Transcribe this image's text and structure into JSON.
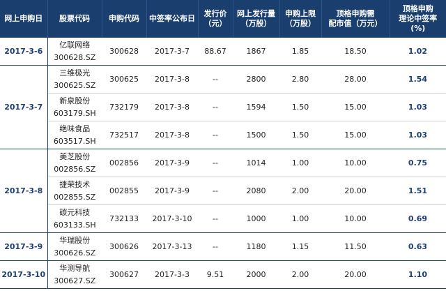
{
  "headers": [
    "网上申购日",
    "股票代码",
    "申购代码",
    "中签率公布日",
    "发行价\n（元）",
    "网上发行量\n（万股）",
    "申购上限\n（万股）",
    "顶格申购需\n配市值（万元）",
    "顶格申购\n理论中签率\n(%)"
  ],
  "groups": [
    {
      "date": "2017-3-6",
      "rows": [
        {
          "name": "亿联网络",
          "code": "300628.SZ",
          "sub_code": "300628",
          "announce": "2017-3-7",
          "price": "88.67",
          "volume": "1867",
          "limit": "1.85",
          "market_value": "18.50",
          "rate": "1.02"
        }
      ]
    },
    {
      "date": "2017-3-7",
      "rows": [
        {
          "name": "三维极光",
          "code": "300625.SZ",
          "sub_code": "300625",
          "announce": "2017-3-8",
          "price": "--",
          "volume": "2800",
          "limit": "2.80",
          "market_value": "28.00",
          "rate": "1.54"
        },
        {
          "name": "新泉股份",
          "code": "603179.SH",
          "sub_code": "732179",
          "announce": "2017-3-8",
          "price": "--",
          "volume": "1594",
          "limit": "1.50",
          "market_value": "15.00",
          "rate": "1.03"
        },
        {
          "name": "绝味食品",
          "code": "603517.SH",
          "sub_code": "732517",
          "announce": "2017-3-8",
          "price": "--",
          "volume": "1500",
          "limit": "1.50",
          "market_value": "15.00",
          "rate": "1.03"
        }
      ]
    },
    {
      "date": "2017-3-8",
      "rows": [
        {
          "name": "美芝股份",
          "code": "002856.SZ",
          "sub_code": "002856",
          "announce": "2017-3-9",
          "price": "--",
          "volume": "1014",
          "limit": "1.00",
          "market_value": "10.00",
          "rate": "0.75"
        },
        {
          "name": "捷荣技术",
          "code": "002855.SZ",
          "sub_code": "002855",
          "announce": "2017-3-9",
          "price": "--",
          "volume": "2080",
          "limit": "2.00",
          "market_value": "20.00",
          "rate": "1.51"
        },
        {
          "name": "碳元科技",
          "code": "603133.SH",
          "sub_code": "732133",
          "announce": "2017-3-10",
          "price": "--",
          "volume": "1000",
          "limit": "1.00",
          "market_value": "10.00",
          "rate": "0.69"
        }
      ]
    },
    {
      "date": "2017-3-9",
      "rows": [
        {
          "name": "华瑞股份",
          "code": "300626.SZ",
          "sub_code": "300626",
          "announce": "2017-3-13",
          "price": "--",
          "volume": "1180",
          "limit": "1.15",
          "market_value": "11.50",
          "rate": "0.63"
        }
      ]
    },
    {
      "date": "2017-3-10",
      "rows": [
        {
          "name": "华测导航",
          "code": "300627.SZ",
          "sub_code": "300627",
          "announce": "2017-3-3",
          "price": "9.51",
          "volume": "2000",
          "limit": "2.00",
          "market_value": "20.00",
          "rate": "1.10"
        }
      ]
    }
  ],
  "colors": {
    "header_bg": "#1a3e6e",
    "accent_text": "#1f3f74",
    "row_line": "#c9d3e0"
  }
}
